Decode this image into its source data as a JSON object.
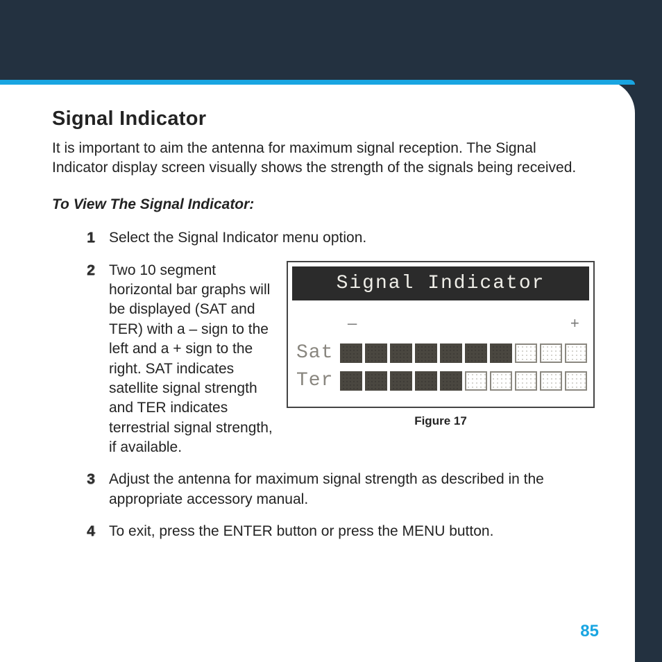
{
  "title": "Signal Indicator",
  "intro": "It is important to aim the antenna for maximum signal reception. The Signal Indicator display screen visually shows the strength of the signals being received.",
  "subhead": "To View The Signal Indicator:",
  "steps": {
    "s1": {
      "num": "1",
      "text": "Select the Signal Indicator menu option."
    },
    "s2": {
      "num": "2",
      "text": "Two 10 segment horizontal bar graphs will be displayed (SAT and TER) with a – sign to the left and a + sign to the right. SAT indicates satellite signal strength and TER indicates terrestrial signal strength, if available."
    },
    "s3": {
      "num": "3",
      "text": "Adjust the antenna for maximum signal strength as described in the appropriate accessory manual."
    },
    "s4": {
      "num": "4",
      "text": "To exit, press the ENTER button or press the MENU button."
    }
  },
  "lcd": {
    "title": "Signal Indicator",
    "minus": "—",
    "plus": "+",
    "sat_label": "Sat",
    "ter_label": "Ter"
  },
  "caption": "Figure 17",
  "page_number": "85",
  "chart_data": {
    "type": "bar",
    "title": "Signal Indicator",
    "xlabel": "",
    "ylabel": "Signal segments filled",
    "ylim": [
      0,
      10
    ],
    "categories": [
      "Sat",
      "Ter"
    ],
    "values": [
      7,
      5
    ],
    "series": [
      {
        "name": "Sat",
        "filled": 7,
        "total": 10
      },
      {
        "name": "Ter",
        "filled": 5,
        "total": 10
      }
    ],
    "scale_labels": {
      "left": "—",
      "right": "+"
    }
  }
}
